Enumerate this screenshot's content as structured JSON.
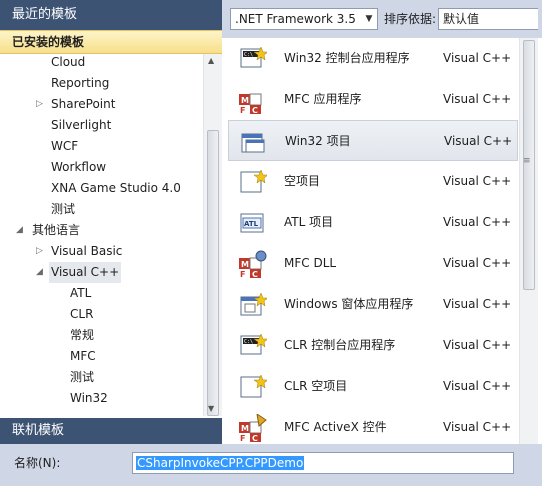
{
  "left_pane": {
    "recent_header": "最近的模板",
    "installed_header": "已安装的模板",
    "tree": [
      {
        "label": "Cloud",
        "arrow": ""
      },
      {
        "label": "Reporting",
        "arrow": ""
      },
      {
        "label": "SharePoint",
        "arrow": "▷"
      },
      {
        "label": "Silverlight",
        "arrow": ""
      },
      {
        "label": "WCF",
        "arrow": ""
      },
      {
        "label": "Workflow",
        "arrow": ""
      },
      {
        "label": "XNA Game Studio 4.0",
        "arrow": ""
      },
      {
        "label": "测试",
        "arrow": ""
      },
      {
        "label": "其他语言",
        "arrow": "◢"
      },
      {
        "label": "Visual Basic",
        "arrow": "▷"
      },
      {
        "label": "Visual C++",
        "arrow": "◢",
        "selected": true
      },
      {
        "label": "ATL",
        "arrow": ""
      },
      {
        "label": "CLR",
        "arrow": ""
      },
      {
        "label": "常规",
        "arrow": ""
      },
      {
        "label": "MFC",
        "arrow": ""
      },
      {
        "label": "测试",
        "arrow": ""
      },
      {
        "label": "Win32",
        "arrow": ""
      }
    ],
    "online_header": "联机模板"
  },
  "toolbar": {
    "framework": ".NET Framework 3.5",
    "sort_label": "排序依据:",
    "sort_value": "默认值"
  },
  "templates": [
    {
      "name": "Win32 控制台应用程序",
      "lang": "Visual C++",
      "icon": "console-app-icon"
    },
    {
      "name": "MFC 应用程序",
      "lang": "Visual C++",
      "icon": "mfc-app-icon"
    },
    {
      "name": "Win32 项目",
      "lang": "Visual C++",
      "icon": "win32-project-icon",
      "selected": true
    },
    {
      "name": "空项目",
      "lang": "Visual C++",
      "icon": "empty-project-icon"
    },
    {
      "name": "ATL 项目",
      "lang": "Visual C++",
      "icon": "atl-project-icon"
    },
    {
      "name": "MFC DLL",
      "lang": "Visual C++",
      "icon": "mfc-dll-icon"
    },
    {
      "name": "Windows 窗体应用程序",
      "lang": "Visual C++",
      "icon": "windows-forms-icon"
    },
    {
      "name": "CLR 控制台应用程序",
      "lang": "Visual C++",
      "icon": "clr-console-icon"
    },
    {
      "name": "CLR 空项目",
      "lang": "Visual C++",
      "icon": "clr-empty-icon"
    },
    {
      "name": "MFC ActiveX 控件",
      "lang": "Visual C++",
      "icon": "mfc-activex-icon"
    }
  ],
  "name_field": {
    "label": "名称(N):",
    "value": "CSharpInvokeCPP.CPPDemo"
  },
  "colors": {
    "header_bg": "#3d5373",
    "installed_bg": "#f7df89",
    "toolbar_bg": "#cfd6e5"
  }
}
